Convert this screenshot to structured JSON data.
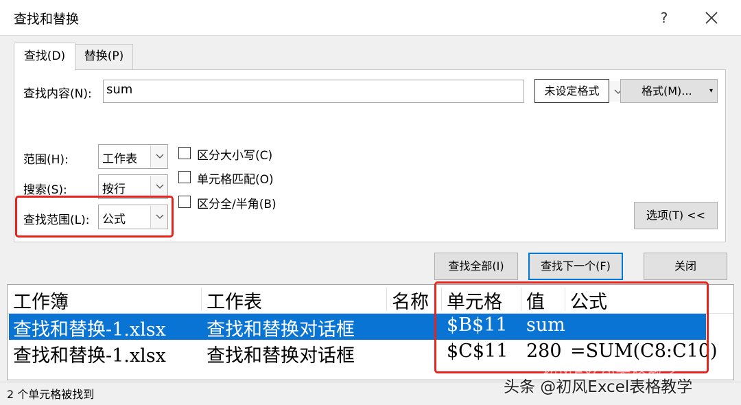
{
  "window": {
    "title": "查找和替换",
    "help_label": "?"
  },
  "tabs": [
    {
      "label": "查找(D)",
      "active": true
    },
    {
      "label": "替换(P)",
      "active": false
    }
  ],
  "find": {
    "label": "查找内容(N):",
    "value": "sum",
    "no_format_label": "未设定格式",
    "format_label": "格式(M)...",
    "format_arrow": "▾"
  },
  "options": {
    "scope_label": "范围(H):",
    "scope_value": "工作表",
    "search_label": "搜索(S):",
    "search_value": "按行",
    "lookin_label": "查找范围(L):",
    "lookin_value": "公式",
    "match_case": {
      "label": "区分大小写(C)",
      "checked": false
    },
    "match_entire": {
      "label": "单元格匹配(O)",
      "checked": false
    },
    "match_byte": {
      "label": "区分全/半角(B)",
      "checked": false
    },
    "options_button": "选项(T) <<"
  },
  "actions": {
    "find_all": "查找全部(I)",
    "find_next": "查找下一个(F)",
    "close": "关闭"
  },
  "results": {
    "columns": [
      "工作簿",
      "工作表",
      "名称",
      "单元格",
      "值",
      "公式"
    ],
    "rows": [
      {
        "workbook": "查找和替换-1.xlsx",
        "sheet": "查找和替换对话框",
        "name": "",
        "cell": "$B$11",
        "value": "sum",
        "formula": "",
        "selected": true
      },
      {
        "workbook": "查找和替换-1.xlsx",
        "sheet": "查找和替换对话框",
        "name": "",
        "cell": "$C$11",
        "value": "280",
        "formula": "=SUM(C8:C10)",
        "selected": false
      }
    ]
  },
  "status": "2 个单元格被找到",
  "watermark": "头条 @初风Excel表格教学",
  "watermark_faint": "初风Excel表格教学",
  "colors": {
    "highlight_box": "#e8221c",
    "selection": "#0a74d4",
    "focus_border": "#0078d7"
  }
}
